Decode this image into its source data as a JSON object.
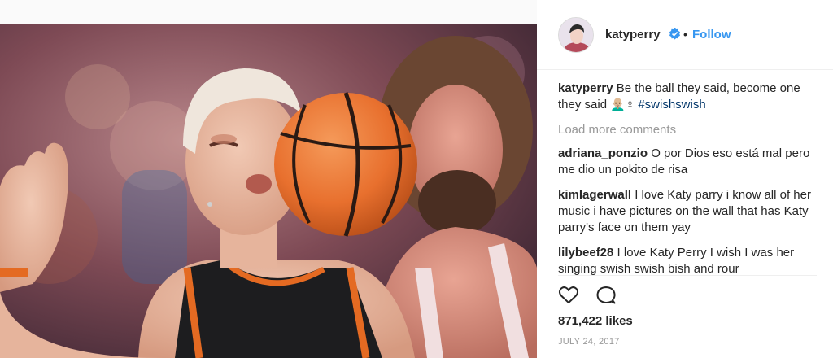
{
  "post": {
    "username": "katyperry",
    "follow_label": "Follow",
    "separator": "•",
    "caption": {
      "author": "katyperry",
      "text": "Be the ball they said, become one they said 👨🏼‍🦲♀",
      "hashtag": "#swishswish"
    },
    "load_more_label": "Load more comments",
    "comments": [
      {
        "author": "adriana_ponzio",
        "text": "O por Dios eso está mal pero me dio un pokito de risa"
      },
      {
        "author": "kimlagerwall",
        "text": "I love Katy parry i know all of her music i have pictures on the wall that has Katy parry's face on them yay"
      },
      {
        "author": "lilybeef28",
        "text": "I love Katy Perry I wish I was her singing swish swish bish and rour"
      }
    ],
    "likes": "871,422 likes",
    "date": "JULY 24, 2017"
  },
  "icons": {
    "avatar": "avatar",
    "verified": "verified-badge-icon",
    "like": "heart-icon",
    "comment": "comment-bubble-icon"
  },
  "colors": {
    "link_blue": "#3897f0",
    "hashtag": "#003569",
    "muted": "#999999",
    "text": "#262626"
  }
}
